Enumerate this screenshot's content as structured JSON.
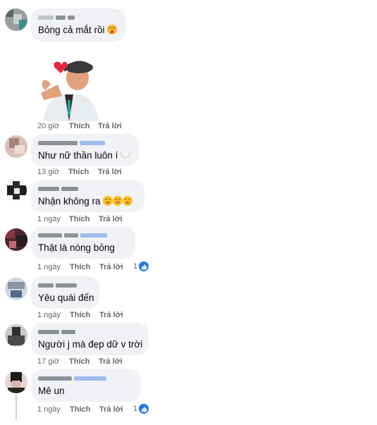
{
  "comments": [
    {
      "text": "Bỏng cả mắt rồi",
      "emoji": "kissing-face-icon"
    },
    {
      "time": "20 giờ",
      "like": "Thích",
      "reply": "Trả lời"
    },
    {
      "text": "Như nữ thần luôn í",
      "emoji": "heart-hands-icon",
      "time": "13 giờ",
      "like": "Thích",
      "reply": "Trả lời"
    },
    {
      "text": "Nhận không ra",
      "emoji": "grinning-face-icon",
      "time": "1 ngày",
      "like": "Thích",
      "reply": "Trả lời"
    },
    {
      "text": "Thật là nóng bỏng",
      "time": "1 ngày",
      "like": "Thích",
      "reply": "Trả lời",
      "reactions": "1"
    },
    {
      "text": "Yêu quái đến",
      "time": "1 ngày",
      "like": "Thích",
      "reply": "Trả lời"
    },
    {
      "text": "Người j mà đẹp dữ v trời",
      "time": "17 giờ",
      "like": "Thích",
      "reply": "Trả lời"
    },
    {
      "text": "Mê un",
      "time": "1 ngày",
      "like": "Thích",
      "reply": "Trả lời",
      "reactions": "1"
    }
  ],
  "colors": {
    "bubble": "#f0f2f5",
    "meta": "#65676b",
    "like_blue": "#1877f2"
  }
}
